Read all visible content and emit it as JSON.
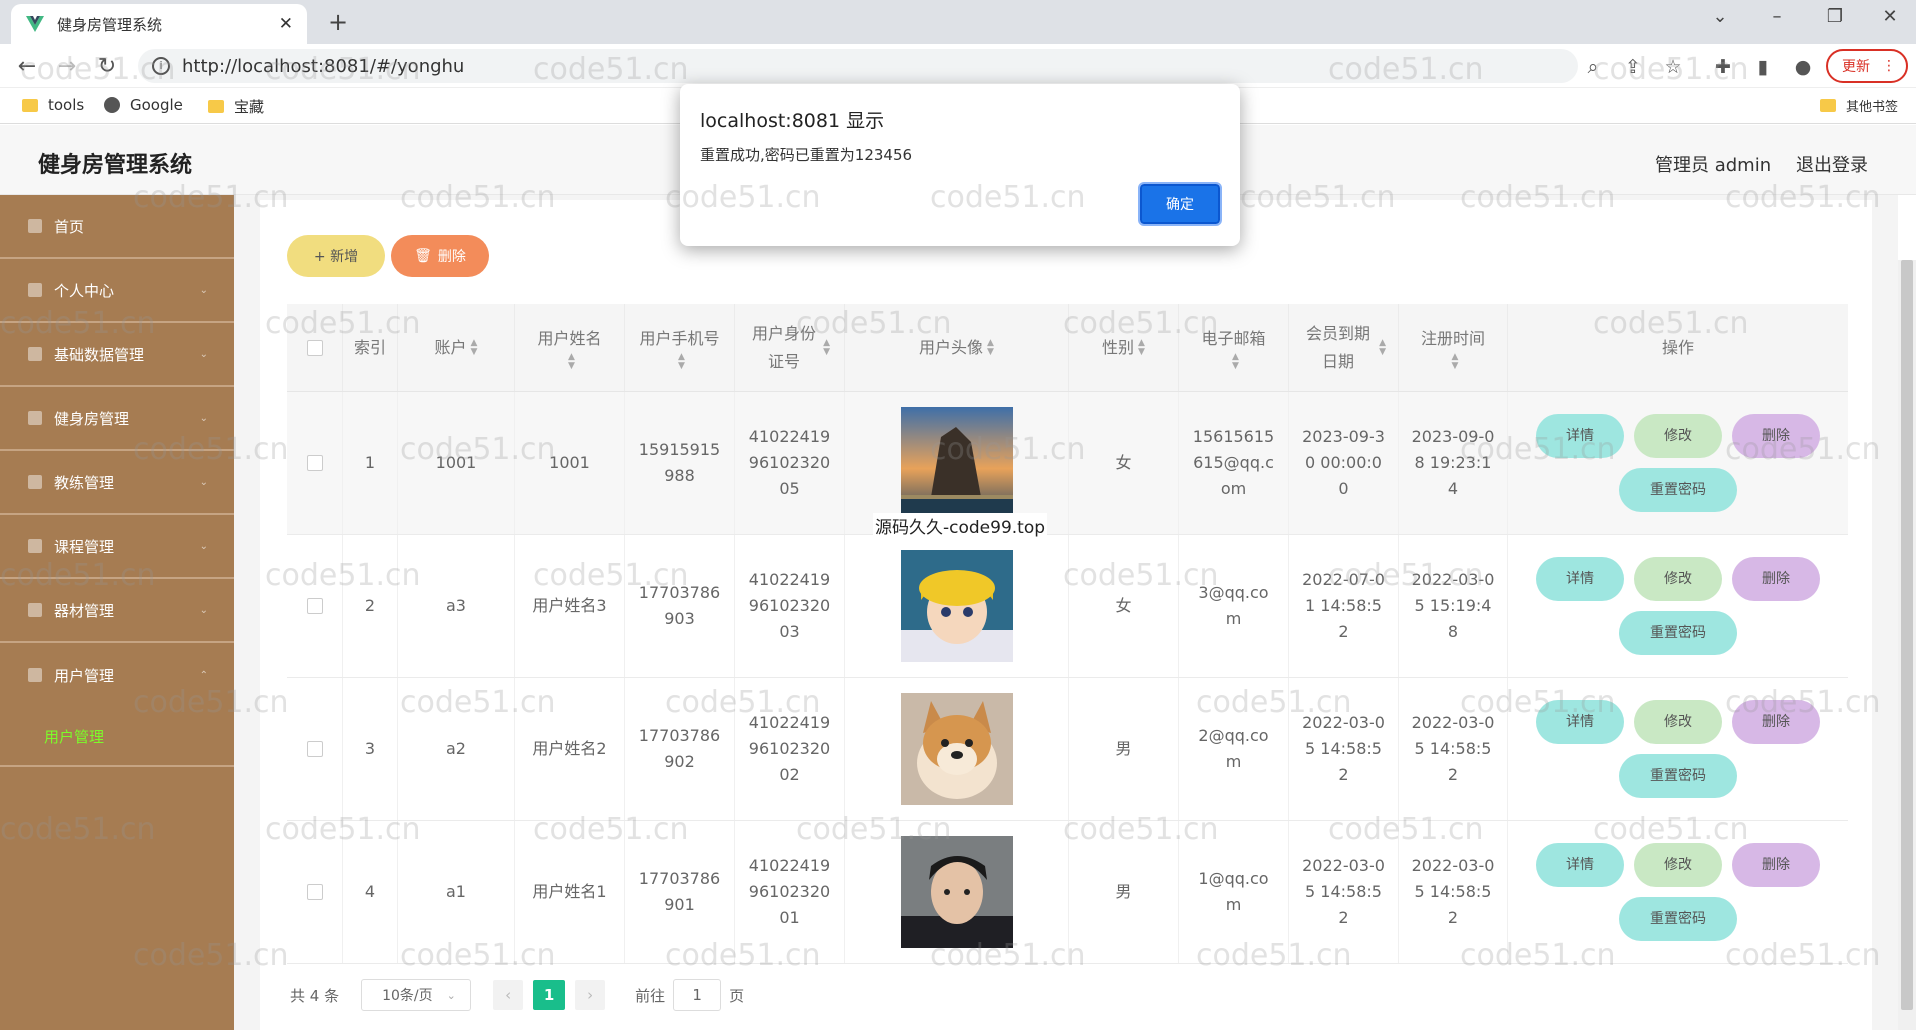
{
  "browser": {
    "tab_title": "健身房管理系统",
    "url": "http://localhost:8081/#/yonghu",
    "update_label": "更新",
    "bookmarks": [
      "tools",
      "Google",
      "宝藏"
    ],
    "other_bookmarks": "其他书签"
  },
  "header": {
    "title": "健身房管理系统",
    "user": "管理员 admin",
    "logout": "退出登录"
  },
  "sidebar": {
    "items": [
      "首页",
      "个人中心",
      "基础数据管理",
      "健身房管理",
      "教练管理",
      "课程管理",
      "器材管理",
      "用户管理"
    ],
    "active_sub": "用户管理"
  },
  "actions": {
    "add": "+ 新增",
    "delete": "删除"
  },
  "table": {
    "headers": [
      "索引",
      "账户",
      "用户姓名",
      "用户手机号",
      "用户身份证号",
      "用户头像",
      "性别",
      "电子邮箱",
      "会员到期日期",
      "注册时间",
      "操作"
    ],
    "rows": [
      {
        "index": "1",
        "account": "1001",
        "name": "1001",
        "phone": "15915915988",
        "idcard": "410224199610232005",
        "gender": "女",
        "email": "15615615615@qq.com",
        "expire": "2023-09-30 00:00:00",
        "registered": "2023-09-08 19:23:14"
      },
      {
        "index": "2",
        "account": "a3",
        "name": "用户姓名3",
        "phone": "17703786903",
        "idcard": "410224199610232003",
        "gender": "女",
        "email": "3@qq.com",
        "expire": "2022-07-01 14:58:52",
        "registered": "2022-03-05 15:19:48"
      },
      {
        "index": "3",
        "account": "a2",
        "name": "用户姓名2",
        "phone": "17703786902",
        "idcard": "410224199610232002",
        "gender": "男",
        "email": "2@qq.com",
        "expire": "2022-03-05 14:58:52",
        "registered": "2022-03-05 14:58:52"
      },
      {
        "index": "4",
        "account": "a1",
        "name": "用户姓名1",
        "phone": "17703786901",
        "idcard": "410224199610232001",
        "gender": "男",
        "email": "1@qq.com",
        "expire": "2022-03-05 14:58:52",
        "registered": "2022-03-05 14:58:52"
      }
    ],
    "op_labels": {
      "detail": "详情",
      "edit": "修改",
      "delete": "删除",
      "reset": "重置密码"
    }
  },
  "pager": {
    "total": "共 4 条",
    "size": "10条/页",
    "current": "1",
    "goto_prefix": "前往",
    "goto_value": "1",
    "goto_suffix": "页"
  },
  "dialog": {
    "title": "localhost:8081 显示",
    "message": "重置成功,密码已重置为123456",
    "ok": "确定"
  },
  "overlay_text": "源码久久-code99.top",
  "watermark": "code51.cn"
}
